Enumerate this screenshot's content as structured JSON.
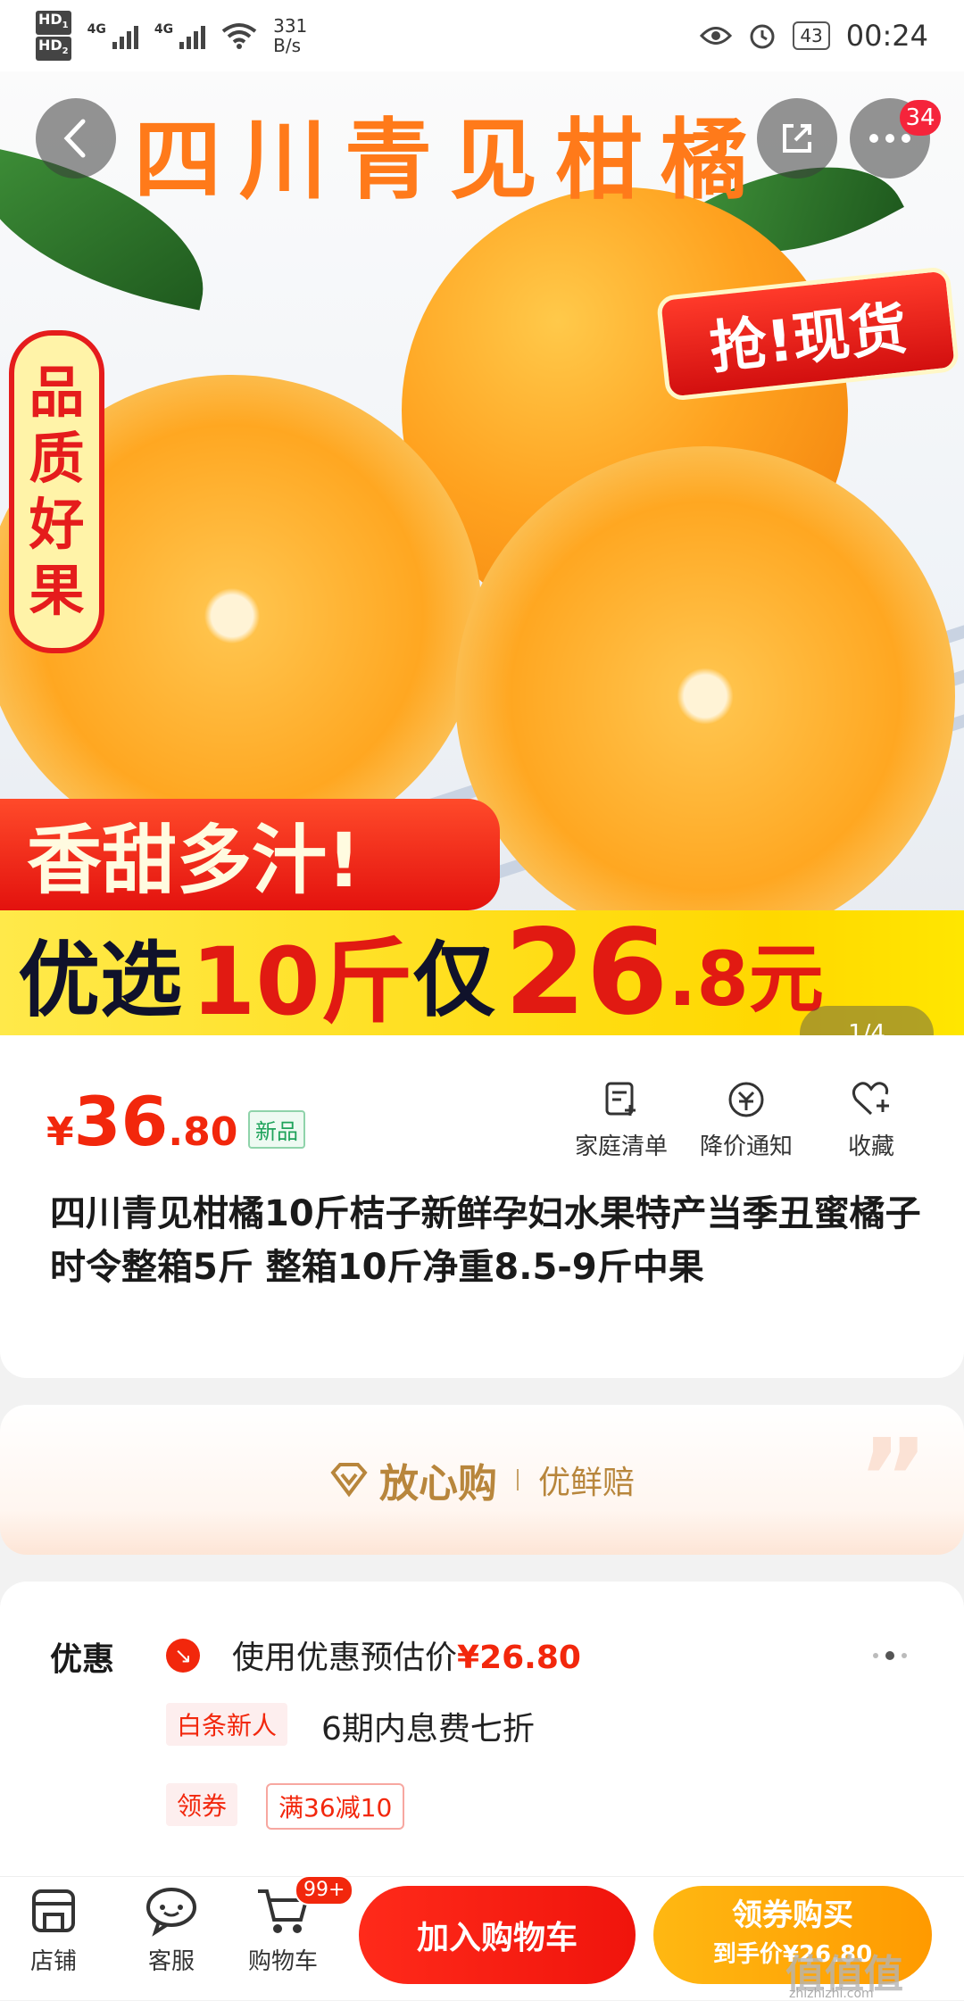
{
  "status_bar": {
    "hd1": "HD",
    "hd1_sub": "1",
    "hd2": "HD",
    "hd2_sub": "2",
    "net1": "4G",
    "net2": "4G",
    "speed_value": "331",
    "speed_unit": "B/s",
    "battery": "43",
    "time": "00:24",
    "icons": [
      "eye-icon",
      "alarm-icon"
    ]
  },
  "hero": {
    "title": "四川青见柑橘",
    "badge_left": [
      "品",
      "质",
      "好",
      "果"
    ],
    "badge_grab": "抢!现货",
    "banner_red": "香甜多汁!",
    "banner_yellow": {
      "part1": "优选",
      "part2": "10斤",
      "part3": "仅",
      "part4": "26",
      "part5": ".8元"
    },
    "pager": "1/4",
    "more_badge": "34"
  },
  "product": {
    "currency": "¥",
    "price_int": "36",
    "price_dec": ".80",
    "tag": "新品",
    "actions": [
      {
        "label": "家庭清单",
        "icon": "list-add-icon"
      },
      {
        "label": "降价通知",
        "icon": "price-drop-icon"
      },
      {
        "label": "收藏",
        "icon": "heart-icon"
      }
    ],
    "title": "四川青见柑橘10斤桔子新鲜孕妇水果特产当季丑蜜橘子时令整箱5斤 整箱10斤净重8.5-9斤中果"
  },
  "guarantee": {
    "main": "放心购",
    "sub": "优鲜赔"
  },
  "discount": {
    "label": "优惠",
    "line1_prefix": "使用优惠预估价",
    "line1_price": "¥26.80",
    "pill1": "白条新人",
    "line2": "6期内息费七折",
    "pill2": "领券",
    "coupon": "满36减10"
  },
  "bottom_bar": {
    "store": "店铺",
    "service": "客服",
    "cart": "购物车",
    "cart_badge": "99+",
    "add_to_cart": "加入购物车",
    "buy_line1": "领券购买",
    "buy_line2": "到手价¥26.80"
  },
  "watermark": {
    "text": "值值值",
    "site": "zhizhizhi.com"
  },
  "colors": {
    "accent_red": "#f2270c",
    "orange_button": "#ffa400",
    "gold": "#b8863c"
  }
}
